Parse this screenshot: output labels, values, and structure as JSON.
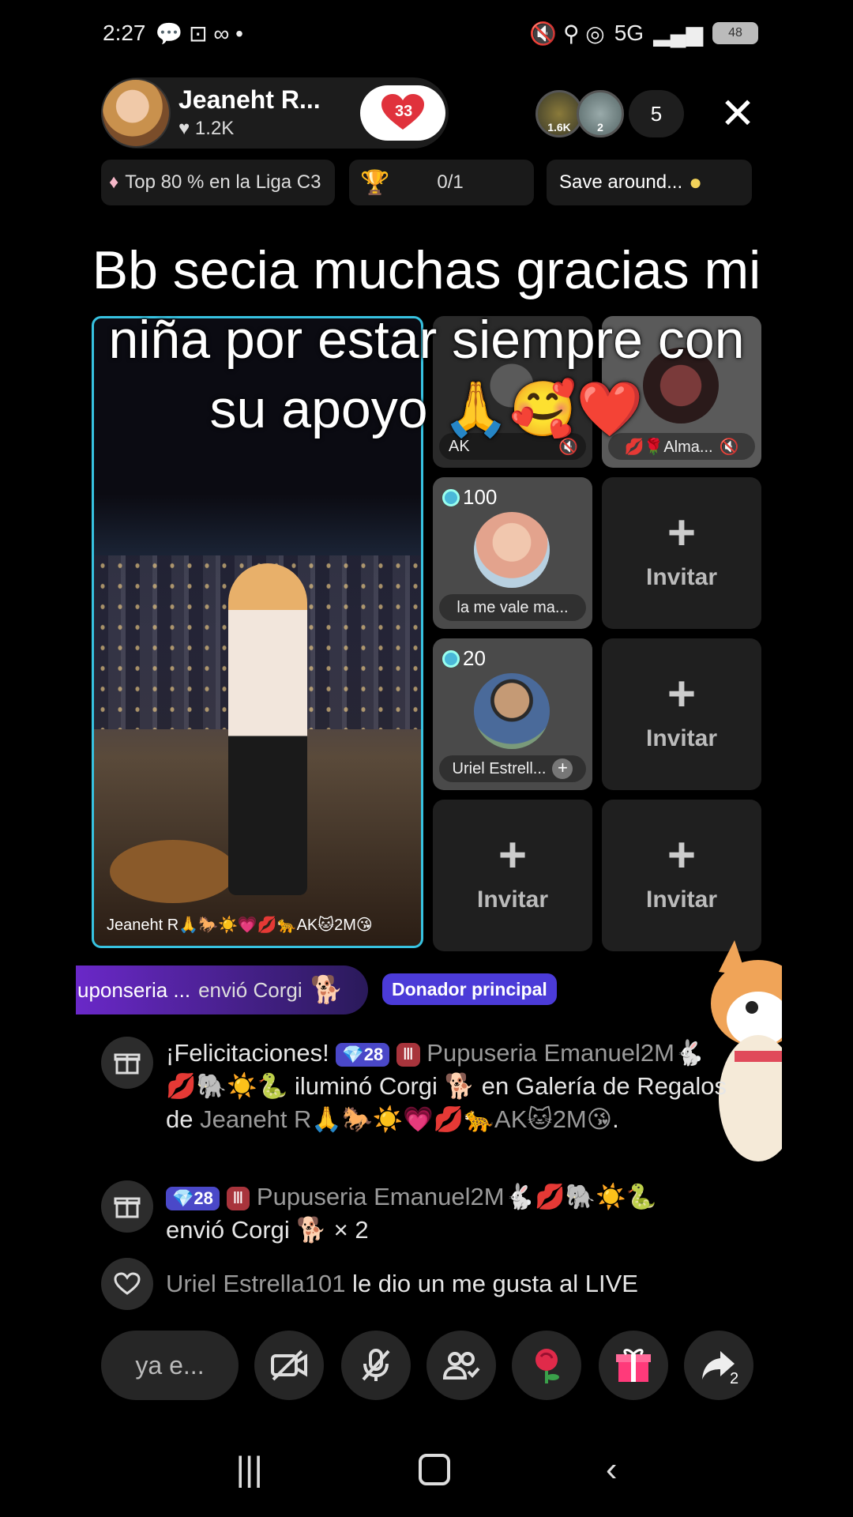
{
  "status_bar": {
    "time": "2:27",
    "left_icons": "💬 ⊡ ∞ •",
    "network": "5G",
    "right_icons": "🔇 ⚲ ◎",
    "battery": "48"
  },
  "host": {
    "name": "Jeaneht R...",
    "likes": "1.2K",
    "follow_count": "33"
  },
  "viewers": {
    "avatar_1_label": "1.6K",
    "avatar_2_label": "2",
    "count": "5"
  },
  "chips": {
    "league": "Top 80 % en la Liga C3",
    "progress": "0/1",
    "save": "Save around..."
  },
  "caption": {
    "text": "Bb secia muchas gracias mi niña por estar siempre con su apoyo 🙏🥰❤️"
  },
  "main_tile": {
    "label": "Jeaneht R🙏🐎☀️💗💋🐆AK🐱2M😘"
  },
  "guests": [
    {
      "score": "100",
      "name": "la me vale ma..."
    },
    {
      "score": "20",
      "name": "Uriel Estrell..."
    }
  ],
  "top_tiles": {
    "left_name": "AK",
    "right_name": "💋🌹Alma..."
  },
  "invite": {
    "plus": "+",
    "label": "Invitar"
  },
  "gift_banner": {
    "text": "uponseria ...",
    "action": "envió Corgi",
    "badge": "Donador principal"
  },
  "chat": [
    {
      "pre": "¡Felicitaciones!",
      "level": "💎28",
      "rank": "Ⅲ",
      "user": "Pupuseria Emanuel2M🐇💋🐘☀️🐍",
      "msg": " iluminó Corgi 🐕 en ",
      "place": "Galería de Regalos de ",
      "target": "Jeaneht R🙏🐎☀️💗💋🐆AK🐱2M😘",
      "end": "."
    },
    {
      "level": "💎28",
      "rank": "Ⅲ",
      "user": "Pupuseria Emanuel2M🐇💋🐘☀️🐍",
      "msg": "envió Corgi 🐕 × 2"
    },
    {
      "user": "Uriel Estrella101",
      "msg": " le dio un me gusta al LIVE"
    }
  ],
  "bottom": {
    "input_placeholder": "ya e...",
    "share_count": "2"
  },
  "icons": [
    "heart-icon",
    "close-icon",
    "diamond-icon",
    "gift-icon",
    "camera-off-icon",
    "mic-off-icon",
    "users-icon",
    "rose-icon",
    "share-icon"
  ],
  "colors": {
    "accent": "#37c2e0",
    "banner": "#6a28c8",
    "badge": "#4b3bd8"
  }
}
